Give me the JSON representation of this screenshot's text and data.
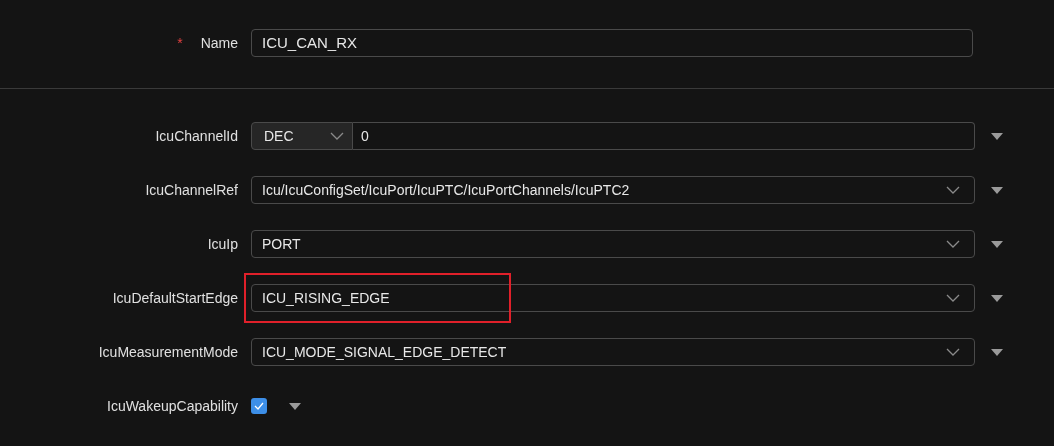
{
  "name_field": {
    "label": "Name",
    "required_mark": "*",
    "value": "ICU_CAN_RX"
  },
  "parameters": [
    {
      "kind": "number",
      "label": "IcuChannelId",
      "format": "DEC",
      "value": "0",
      "highlighted": false
    },
    {
      "kind": "select",
      "label": "IcuChannelRef",
      "value": "Icu/IcuConfigSet/IcuPort/IcuPTC/IcuPortChannels/IcuPTC2",
      "highlighted": false
    },
    {
      "kind": "select",
      "label": "IcuIp",
      "value": "PORT",
      "highlighted": false
    },
    {
      "kind": "select",
      "label": "IcuDefaultStartEdge",
      "value": "ICU_RISING_EDGE",
      "highlighted": true
    },
    {
      "kind": "select",
      "label": "IcuMeasurementMode",
      "value": "ICU_MODE_SIGNAL_EDGE_DETECT",
      "highlighted": false
    },
    {
      "kind": "checkbox",
      "label": "IcuWakeupCapability",
      "checked": true,
      "highlighted": false
    }
  ]
}
